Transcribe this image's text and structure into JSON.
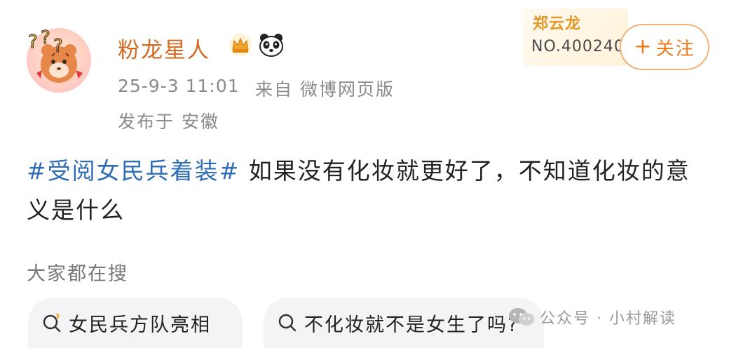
{
  "user": {
    "name": "粉龙星人",
    "time": "25-9-3 11:01",
    "source": "来自 微博网页版",
    "location": "发布于 安徽"
  },
  "badge": {
    "name": "郑云龙",
    "number": "NO.400240"
  },
  "follow": {
    "plus": "+",
    "label": "关注"
  },
  "post": {
    "hashtag": "#受阅女民兵着装#",
    "text": " 如果没有化妆就更好了，不知道化妆的意义是什么"
  },
  "trending": {
    "label": "大家都在搜",
    "items": [
      "女民兵方队亮相",
      "不化妆就不是女生了吗?"
    ]
  },
  "watermark": {
    "text": "公众号 · 小村解读"
  },
  "icons": {
    "crown": "crown-icon",
    "panda": "panda-icon",
    "search": "search-icon",
    "hot_search": "hot-search-icon",
    "wechat": "wechat-icon"
  },
  "colors": {
    "username": "#d2691e",
    "hashtag": "#2f6db7",
    "follow": "#f07a1a",
    "meta": "#8a8a8a"
  }
}
